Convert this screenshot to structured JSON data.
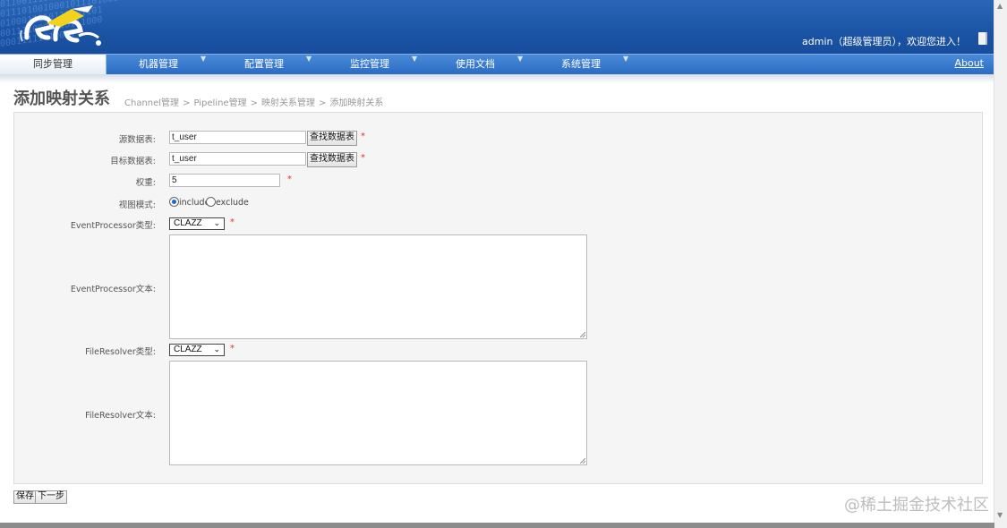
{
  "header": {
    "binary_text": "0110011101110111011010\n0111010010001011101000111\n0100011110111001101\n0011110001010111000\n00011111010011",
    "user_info": "admin（超级管理员），欢迎您进入！"
  },
  "nav": {
    "items": [
      {
        "label": "同步管理"
      },
      {
        "label": "机器管理"
      },
      {
        "label": "配置管理"
      },
      {
        "label": "监控管理"
      },
      {
        "label": "使用文档"
      },
      {
        "label": "系统管理"
      }
    ],
    "about": "About"
  },
  "page": {
    "title": "添加映射关系",
    "breadcrumb": [
      "Channel管理",
      "Pipeline管理",
      "映射关系管理",
      "添加映射关系"
    ],
    "breadcrumb_sep": ">"
  },
  "form": {
    "source_label": "源数据表:",
    "source_value": "t_user",
    "find_btn": "查找数据表",
    "target_label": "目标数据表:",
    "target_value": "t_user",
    "weight_label": "权重:",
    "weight_value": "5",
    "view_label": "视图模式:",
    "view_include": "include",
    "view_exclude": "exclude",
    "ep_type_label": "EventProcessor类型:",
    "ep_type_value": "CLAZZ",
    "ep_text_label": "EventProcessor文本:",
    "fr_type_label": "FileResolver类型:",
    "fr_type_value": "CLAZZ",
    "fr_text_label": "FileResolver文本:",
    "required_mark": "*"
  },
  "actions": {
    "save": "保存",
    "next": "下一步"
  },
  "watermark": "@稀土掘金技术社区"
}
